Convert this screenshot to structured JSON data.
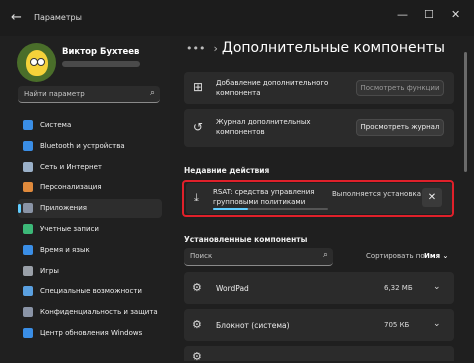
{
  "window": {
    "title": "Параметры",
    "back_glyph": "←",
    "minimize_glyph": "—",
    "maximize_glyph": "☐",
    "close_glyph": "✕"
  },
  "user": {
    "name": "Виктор Бухтеев"
  },
  "search": {
    "placeholder": "Найти параметр",
    "icon": "search-icon"
  },
  "nav": [
    {
      "label": "Система",
      "icon": "monitor-icon",
      "color": "#3a8ee6"
    },
    {
      "label": "Bluetooth и устройства",
      "icon": "bluetooth-icon",
      "color": "#3a8ee6"
    },
    {
      "label": "Сеть и Интернет",
      "icon": "wifi-icon",
      "color": "#9ab0c8"
    },
    {
      "label": "Персонализация",
      "icon": "brush-icon",
      "color": "#e08a3c"
    },
    {
      "label": "Приложения",
      "icon": "apps-icon",
      "color": "#8a94a6",
      "active": true
    },
    {
      "label": "Учетные записи",
      "icon": "person-icon",
      "color": "#3cb878"
    },
    {
      "label": "Время и язык",
      "icon": "globe-icon",
      "color": "#3a8ee6"
    },
    {
      "label": "Игры",
      "icon": "gamepad-icon",
      "color": "#9aa0a8"
    },
    {
      "label": "Специальные возможности",
      "icon": "accessibility-icon",
      "color": "#5aa0e0"
    },
    {
      "label": "Конфиденциальность и защита",
      "icon": "shield-icon",
      "color": "#8a94a6"
    },
    {
      "label": "Центр обновления Windows",
      "icon": "update-icon",
      "color": "#3a8ee6"
    }
  ],
  "header": {
    "dots": "•••",
    "separator": "›",
    "title": "Дополнительные компоненты"
  },
  "cards": [
    {
      "text": "Добавление дополнительного компонента",
      "button": "Посмотреть функции",
      "icon": "grid-add-icon",
      "icon_glyph": "⊞"
    },
    {
      "text": "Журнал дополнительных компонентов",
      "button": "Просмотреть журнал",
      "icon": "history-icon",
      "icon_glyph": "↺"
    }
  ],
  "recent": {
    "heading": "Недавние действия",
    "name": "RSAT: средства управления групповыми политиками",
    "status": "Выполняется установка",
    "progress": 0.3,
    "icon": "download-icon",
    "icon_glyph": "⤓",
    "close_glyph": "✕"
  },
  "installed": {
    "heading": "Установленные компоненты",
    "search_placeholder": "Поиск",
    "sort_label": "Сортировать по:",
    "sort_value": "Имя ⌄",
    "items": [
      {
        "name": "WordPad",
        "size": "6,32 МБ",
        "icon": "wordpad-icon",
        "icon_glyph": "⚙"
      },
      {
        "name": "Блокнот (система)",
        "size": "705 КБ",
        "icon": "notepad-icon",
        "icon_glyph": "⚙"
      },
      {
        "name": "",
        "size": "",
        "icon": "component-icon",
        "icon_glyph": "⚙"
      }
    ],
    "chevron_glyph": "⌄"
  }
}
